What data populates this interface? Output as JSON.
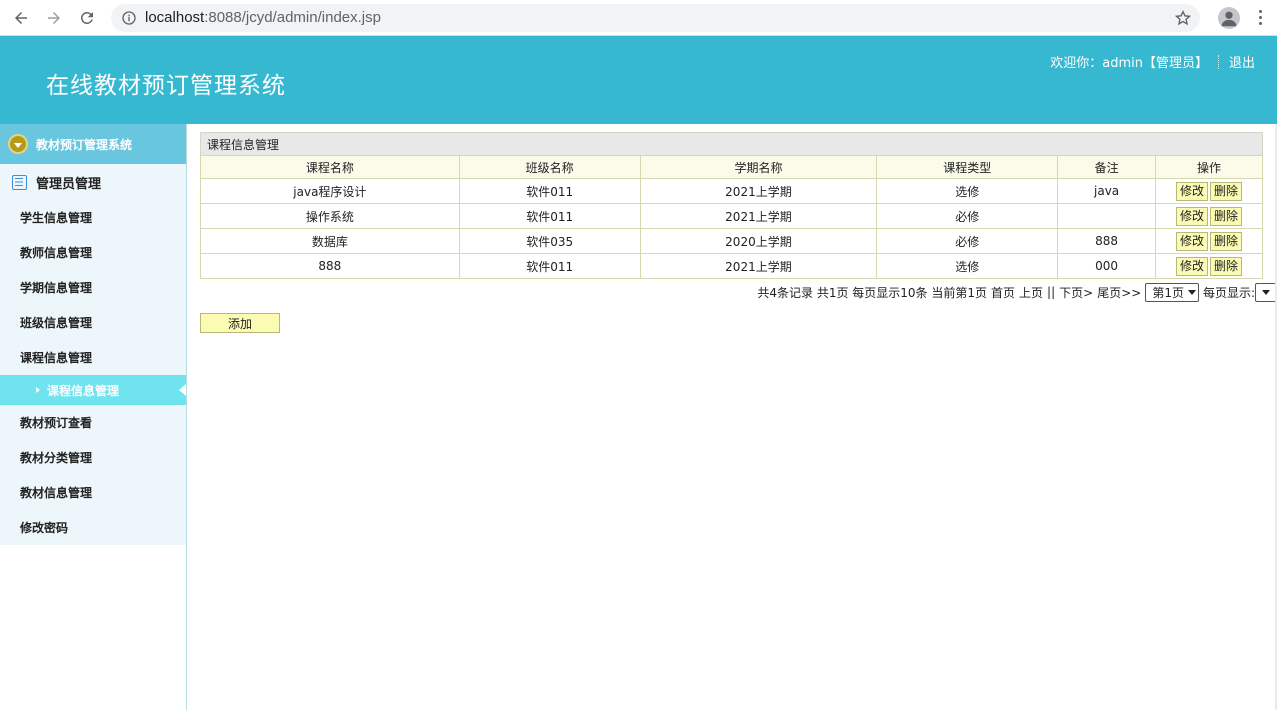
{
  "browser": {
    "url_host": "localhost",
    "url_rest": ":8088/jcyd/admin/index.jsp"
  },
  "header": {
    "title": "在线教材预订管理系统",
    "welcome": "欢迎你：admin【管理员】",
    "logout": "退出"
  },
  "sidebar": {
    "system_title": "教材预订管理系统",
    "group": "管理员管理",
    "items": [
      {
        "label": "学生信息管理"
      },
      {
        "label": "教师信息管理"
      },
      {
        "label": "学期信息管理"
      },
      {
        "label": "班级信息管理"
      },
      {
        "label": "课程信息管理"
      }
    ],
    "active_sub": "课程信息管理",
    "items_after": [
      {
        "label": "教材预订查看"
      },
      {
        "label": "教材分类管理"
      },
      {
        "label": "教材信息管理"
      },
      {
        "label": "修改密码"
      }
    ]
  },
  "panel": {
    "title": "课程信息管理",
    "columns": [
      "课程名称",
      "班级名称",
      "学期名称",
      "课程类型",
      "备注",
      "操作"
    ],
    "rows": [
      {
        "course": "java程序设计",
        "class": "软件011",
        "term": "2021上学期",
        "type": "选修",
        "note": "java"
      },
      {
        "course": "操作系统",
        "class": "软件011",
        "term": "2021上学期",
        "type": "必修",
        "note": ""
      },
      {
        "course": "数据库",
        "class": "软件035",
        "term": "2020上学期",
        "type": "必修",
        "note": "888"
      },
      {
        "course": "888",
        "class": "软件011",
        "term": "2021上学期",
        "type": "选修",
        "note": "000"
      }
    ],
    "edit_label": "修改",
    "delete_label": "删除"
  },
  "pager": {
    "summary": "共4条记录 共1页 每页显示10条 当前第1页",
    "first": "首页",
    "prev": "上页",
    "divider": "||",
    "next": "下页>",
    "last": "尾页>>",
    "page_select": "第1页",
    "per_page_label": "每页显示:"
  },
  "add_label": "添加",
  "colors": {
    "header_bg": "#37b8d1",
    "sidebar_active": "#6fe3ee",
    "button_bg": "#fbfbb4"
  }
}
